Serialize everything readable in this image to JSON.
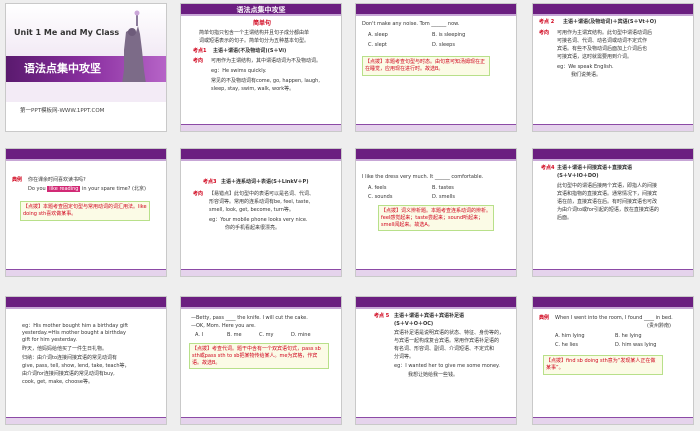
{
  "slides": [
    {
      "num": "1",
      "unit": "Unit 1   Me and My Class",
      "title": "语法点集中攻坚",
      "site": "第一PPT模板网-WWW.1PPT.COM"
    },
    {
      "num": "2",
      "title": "语法点集中攻坚",
      "heading": "简单句",
      "line1": "简单句指只包含一个主谓结构并且句子成分都由单",
      "line2": "词或短语表示的句子。简单句分为五种基本句型。",
      "kp": "考点1",
      "kp_text": "主语＋谓语(不及物动词)(S＋Vi)",
      "note": "考向",
      "note1": "可用作为主谓结构，其中谓语动词为不及物动词。",
      "eg": "eg：He swims quickly.",
      "line3": "常见的不及物动词有come, go, happen, laugh,",
      "line4": "sleep, stay, swim, walk, work等。"
    },
    {
      "num": "3",
      "q_pre": "Don't make any noise. Tom",
      "q_post": "now.",
      "opts": [
        "A. sleep",
        "B. is sleeping",
        "C. slept",
        "D. sleeps"
      ],
      "tip": "【点拨】本题考查句型与时态。由句意可知汤姆现在正在睡觉，应用现在进行时。故选B。"
    },
    {
      "num": "4",
      "kp": "考点 2",
      "kp_text": "主语＋谓语(及物动词)＋宾语(S＋Vt＋O)",
      "note": "考向",
      "lines": [
        "可用作为主谓宾结构。此句型中谓语动词后",
        "可接名词、代词、动名词或动词不定式作",
        "宾语。有些不及物动词后面加上介词后也",
        "可接宾语，这时就需要用到介词。"
      ],
      "eg": "eg：We speak English.",
      "trans": "我们说英语。"
    },
    {
      "num": "5",
      "label": "典例",
      "q": "你在课余时间喜欢读书吗?",
      "q2_pre": "Do you",
      "q2_ans": "like reading",
      "q2_post": "in your spare time? (北京)",
      "tip": "【点拨】本题考查固定句型与常用动词的词汇用法。like doing sth喜欢做某事。"
    },
    {
      "num": "6",
      "kp": "考点3",
      "kp_text": "主语＋连系动词＋表语(S＋LinkV＋P)",
      "note": "考向",
      "lines": [
        "【易错点】此句型中的表语可以是名词、代词、",
        "形容词等。常用的连系动词有be, feel, taste,",
        "smell, look, get, become, turn等。"
      ],
      "eg": "eg：Your mobile phone looks very nice.",
      "trans": "你的手机看起来很漂亮。"
    },
    {
      "num": "7",
      "q_pre": "I like the dress very much. It",
      "q_post": "comfortable.",
      "opts": [
        "A. feels",
        "B. tastes",
        "C. sounds",
        "D. smells"
      ],
      "tip": "【点拨】词义辨析题。本题考查连系动词的辨析。feel感觉起来；taste尝起来；sound听起来；smell闻起来。故选A。"
    },
    {
      "num": "8",
      "kp": "考点4",
      "kp_text": "主语＋谓语＋间接宾语＋直接宾语",
      "kp2": "(S＋V＋IO＋DO)",
      "lines": [
        "此句型中的谓语后接两个宾语，即指人的间接",
        "宾语和指物的直接宾语。通常情况下，间接宾",
        "语在前，直接宾语在后。有时间接宾语也可改",
        "为由介词to或for引起的短语，放在直接宾语的",
        "后面。"
      ]
    },
    {
      "num": "9",
      "lines": [
        "eg：His mother bought him a birthday gift",
        "yesterday.=His mother bought a birthday",
        "gift for him yesterday.",
        "昨天，他妈妈给他买了一件生日礼物。",
        "归纳：由介词to连接间接宾语的常见动词有",
        "give, pass, tell, show, lend, take, teach等，",
        "由介词for连接间接宾语的常见动词有buy,",
        "cook, get, make, choose等。"
      ]
    },
    {
      "num": "10",
      "q_pre": "—Betty, pass",
      "q_post": "the knife. I will cut the cake.",
      "q2": "—OK, Mom. Here you are.",
      "opts": [
        "A. I",
        "B. me",
        "C. my",
        "D. mine"
      ],
      "tip": "【点拨】考查代词。题干中含有一个双宾语句式，pass sb sth或pass sth to sb把某物传给某人。me为宾格，作宾语。故选B。"
    },
    {
      "num": "11",
      "kp": "考点 5",
      "kp_text": "主语＋谓语＋宾语＋宾语补足语",
      "kp2": "(S＋V＋O＋OC)",
      "lines": [
        "宾语补足语是说明宾语的状态、特征、身份等的，",
        "与宾语一起构成复合宾语。常用作宾语补足语的",
        "有名词、形容词、副词、介词短语、不定式和",
        "分词等。"
      ],
      "eg": "eg：I wanted her to give me some money.",
      "trans": "我想让她给我一些钱。"
    },
    {
      "num": "12",
      "label": "典例",
      "q_pre": "When I went into the room, I found",
      "q_post": "in bed.",
      "src": "(贵州黔南)",
      "opts": [
        "A. him lying",
        "B. he lying",
        "C. he lies",
        "D. him was lying"
      ],
      "tip": "【点拨】find sb doing sth意为“发现某人正在做某事”。"
    }
  ],
  "colors": {
    "purple": "#6b1e80",
    "red": "#d0021b",
    "tip_border": "#b8e08a"
  }
}
